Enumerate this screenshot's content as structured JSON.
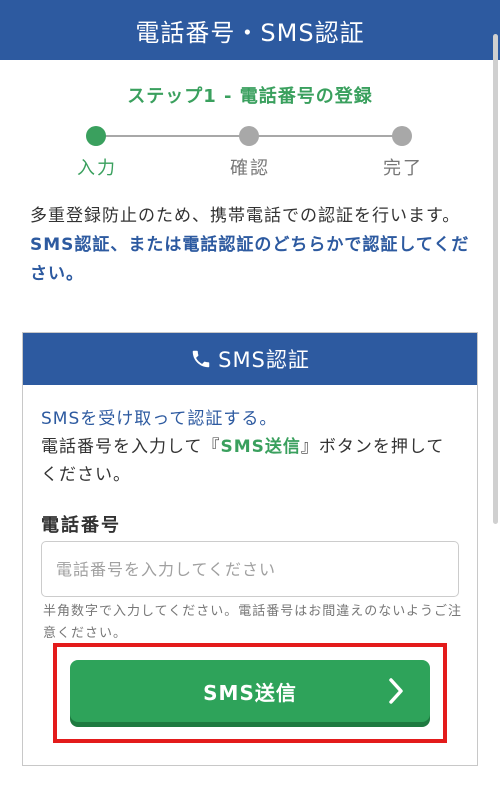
{
  "header": {
    "title": "電話番号・SMS認証"
  },
  "step": {
    "title": "ステップ1 - 電話番号の登録",
    "labels": [
      "入力",
      "確認",
      "完了"
    ]
  },
  "intro": {
    "line1": "多重登録防止のため、携帯電話での認証を行います。",
    "line2": "SMS認証、または電話認証のどちらかで認証してください。"
  },
  "card": {
    "title": "SMS認証",
    "lead": "SMSを受け取って認証する。",
    "instruction_before": "電話番号を入力して『",
    "instruction_highlight": "SMS送信",
    "instruction_after": "』ボタンを押してください。",
    "field_label": "電話番号",
    "field_placeholder": "電話番号を入力してください",
    "hint": "半角数字で入力してください。電話番号はお間違えのないようご注意ください。",
    "button_label": "SMS送信"
  },
  "colors": {
    "primary_blue": "#2d5aa0",
    "accent_green": "#3aa05e",
    "button_green": "#2ea35a",
    "highlight_red": "#e31b1b"
  },
  "icons": {
    "card_title": "phone-icon",
    "button": "chevron-right-icon"
  }
}
